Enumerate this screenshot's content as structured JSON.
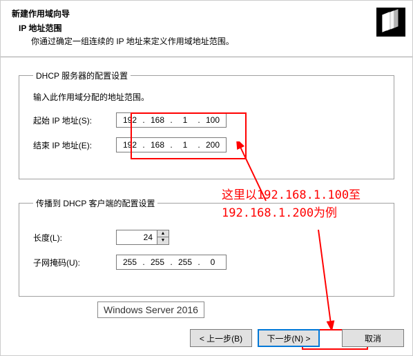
{
  "header": {
    "title": "新建作用域向导",
    "subtitle": "IP 地址范围",
    "desc": "你通过确定一组连续的 IP 地址来定义作用域地址范围。"
  },
  "group1": {
    "legend": "DHCP 服务器的配置设置",
    "instr": "输入此作用域分配的地址范围。",
    "start_label": "起始 IP 地址(S):",
    "end_label": "结束 IP 地址(E):",
    "start_ip": {
      "a": "192",
      "b": "168",
      "c": "1",
      "d": "100"
    },
    "end_ip": {
      "a": "192",
      "b": "168",
      "c": "1",
      "d": "200"
    }
  },
  "group2": {
    "legend": "传播到 DHCP 客户端的配置设置",
    "length_label": "长度(L):",
    "length_value": "24",
    "mask_label": "子网掩码(U):",
    "mask": {
      "a": "255",
      "b": "255",
      "c": "255",
      "d": "0"
    }
  },
  "annotation": {
    "text": "这里以192.168.1.100至\n192.168.1.200为例"
  },
  "footer": {
    "back": "< 上一步(B)",
    "next": "下一步(N) >",
    "cancel": "取消"
  },
  "watermark": "Windows Server 2016"
}
